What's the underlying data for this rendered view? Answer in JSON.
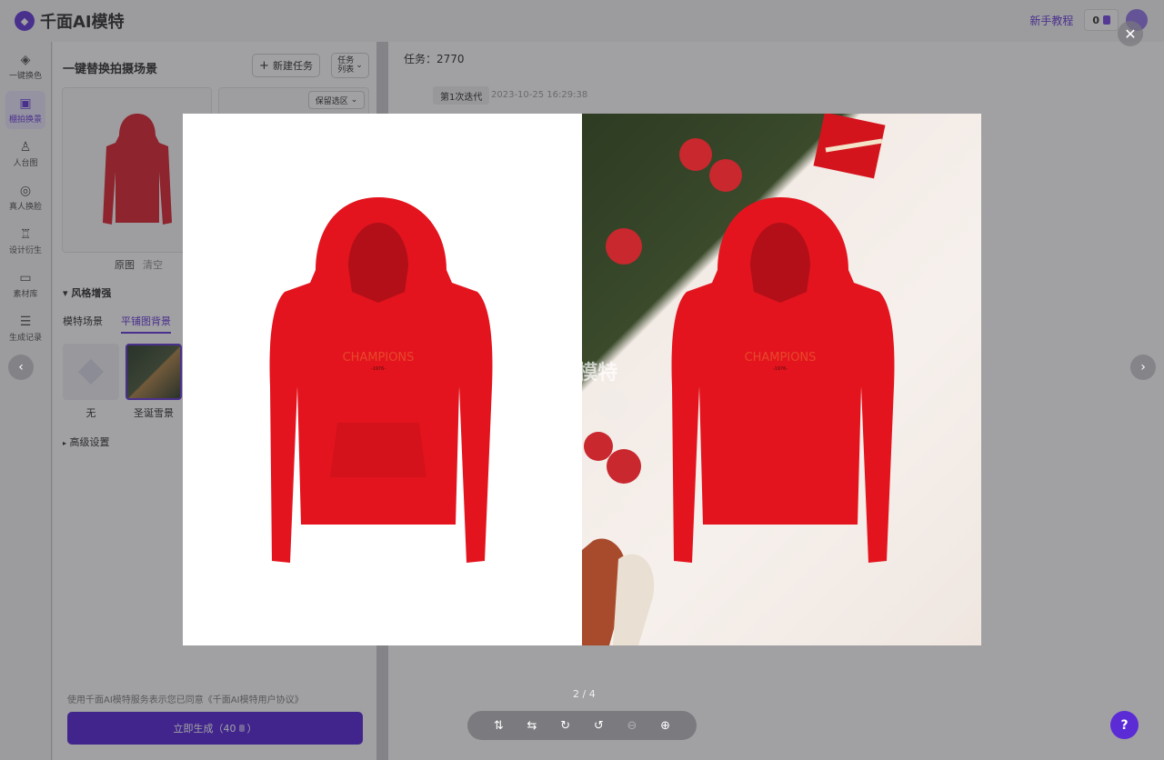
{
  "app": {
    "title": "千面AI模特",
    "tutorial": "新手教程",
    "credits": "0"
  },
  "sidebar": {
    "items": [
      {
        "label": "一键换色",
        "icon": "paint-bucket-icon"
      },
      {
        "label": "棚拍换景",
        "icon": "scene-icon"
      },
      {
        "label": "人台图",
        "icon": "mannequin-icon"
      },
      {
        "label": "真人换脸",
        "icon": "face-swap-icon"
      },
      {
        "label": "设计衍生",
        "icon": "shirt-icon"
      },
      {
        "label": "素材库",
        "icon": "folder-icon"
      },
      {
        "label": "生成记录",
        "icon": "list-icon"
      }
    ]
  },
  "panel": {
    "title": "一键替换拍摄场景",
    "new_task": "新建任务",
    "task_list": "任务列表",
    "keep_area": "保留选区",
    "original": "原图",
    "clear": "清空",
    "style_section": "风格增强",
    "tabs": [
      "模特场景",
      "平铺图背景"
    ],
    "options": [
      "无",
      "圣诞雪景"
    ],
    "advanced": "高级设置",
    "agreement": "使用千面AI模特服务表示您已同意《千面AI模特用户协议》",
    "generate": "立即生成（40",
    "generate_end": "）"
  },
  "main": {
    "task": "任务：2770",
    "iteration": "第1次迭代",
    "time": "2023-10-25 16:29:38"
  },
  "viewer": {
    "counter": "2 / 4",
    "hoodie_text": "CHAMPIONS",
    "hoodie_sub": "-1976-",
    "watermark": "千面AI模特"
  }
}
